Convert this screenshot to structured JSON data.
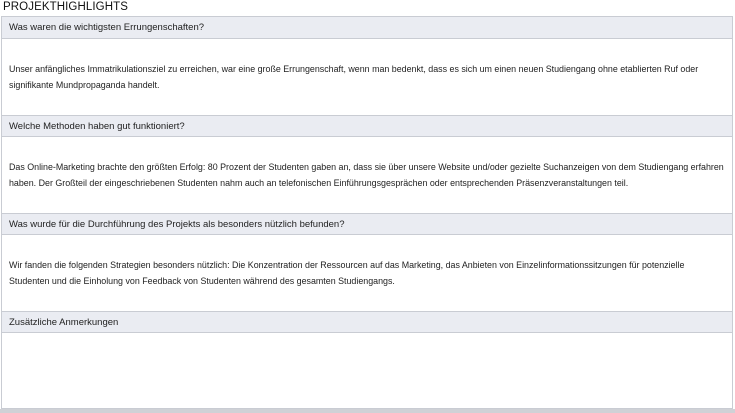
{
  "page_title": "PROJEKTHIGHLIGHTS",
  "sections": [
    {
      "question": "Was waren die wichtigsten Errungenschaften?",
      "answer": "Unser anfängliches Immatrikulationsziel zu erreichen, war eine große Errungenschaft, wenn man bedenkt, dass es sich um einen neuen Studiengang ohne etablierten Ruf oder signifikante Mundpropaganda handelt."
    },
    {
      "question": "Welche Methoden haben gut funktioniert?",
      "answer": "Das Online-Marketing brachte den größten Erfolg: 80 Prozent der Studenten gaben an, dass sie über unsere Website und/oder gezielte Suchanzeigen von dem Studiengang erfahren haben. Der Großteil der eingeschriebenen Studenten nahm auch an telefonischen Einführungsgesprächen oder entsprechenden Präsenzveranstaltungen teil."
    },
    {
      "question": "Was wurde für die Durchführung des Projekts als besonders nützlich befunden?",
      "answer": "Wir fanden die folgenden Strategien besonders nützlich: Die Konzentration der Ressourcen auf das Marketing, das Anbieten von Einzelinformationssitzungen für potenzielle Studenten und die Einholung von Feedback von Studenten während des gesamten Studiengangs."
    },
    {
      "question": "Zusätzliche Anmerkungen",
      "answer": ""
    }
  ]
}
